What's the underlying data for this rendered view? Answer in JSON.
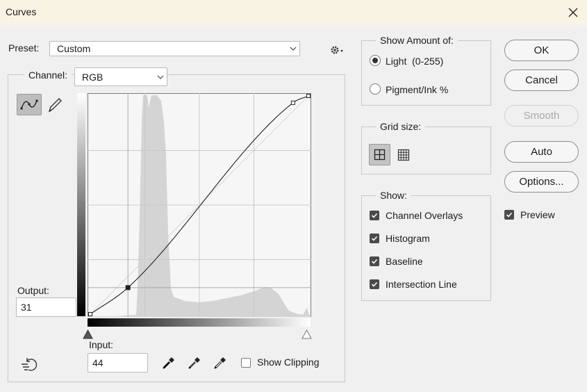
{
  "window": {
    "title": "Curves"
  },
  "preset": {
    "label": "Preset:",
    "value": "Custom"
  },
  "channel": {
    "label": "Channel:",
    "value": "RGB"
  },
  "output": {
    "label": "Output:",
    "value": "31"
  },
  "input": {
    "label": "Input:",
    "value": "44"
  },
  "show_clipping": {
    "label": "Show Clipping",
    "checked": false
  },
  "show_amount": {
    "title": "Show Amount of:",
    "options": [
      {
        "label": "Light  (0-255)",
        "selected": true
      },
      {
        "label": "Pigment/Ink %",
        "selected": false
      }
    ]
  },
  "grid_size": {
    "title": "Grid size:",
    "selected": "simple"
  },
  "show": {
    "title": "Show:",
    "items": [
      {
        "label": "Channel Overlays",
        "checked": true
      },
      {
        "label": "Histogram",
        "checked": true
      },
      {
        "label": "Baseline",
        "checked": true
      },
      {
        "label": "Intersection Line",
        "checked": true
      }
    ]
  },
  "buttons": {
    "ok": "OK",
    "cancel": "Cancel",
    "smooth": "Smooth",
    "auto": "Auto",
    "options": "Options..."
  },
  "preview": {
    "label": "Preview",
    "checked": true
  },
  "curve": {
    "range": [
      0,
      255
    ],
    "points": [
      [
        0,
        0
      ],
      [
        44,
        31
      ],
      [
        237,
        247
      ],
      [
        255,
        255
      ]
    ],
    "selected_point": [
      44,
      31
    ]
  },
  "colors": {
    "accent_check": "#4a4a4a",
    "histogram": "#d4d4d4",
    "titlebar": "#f8f3e3"
  }
}
